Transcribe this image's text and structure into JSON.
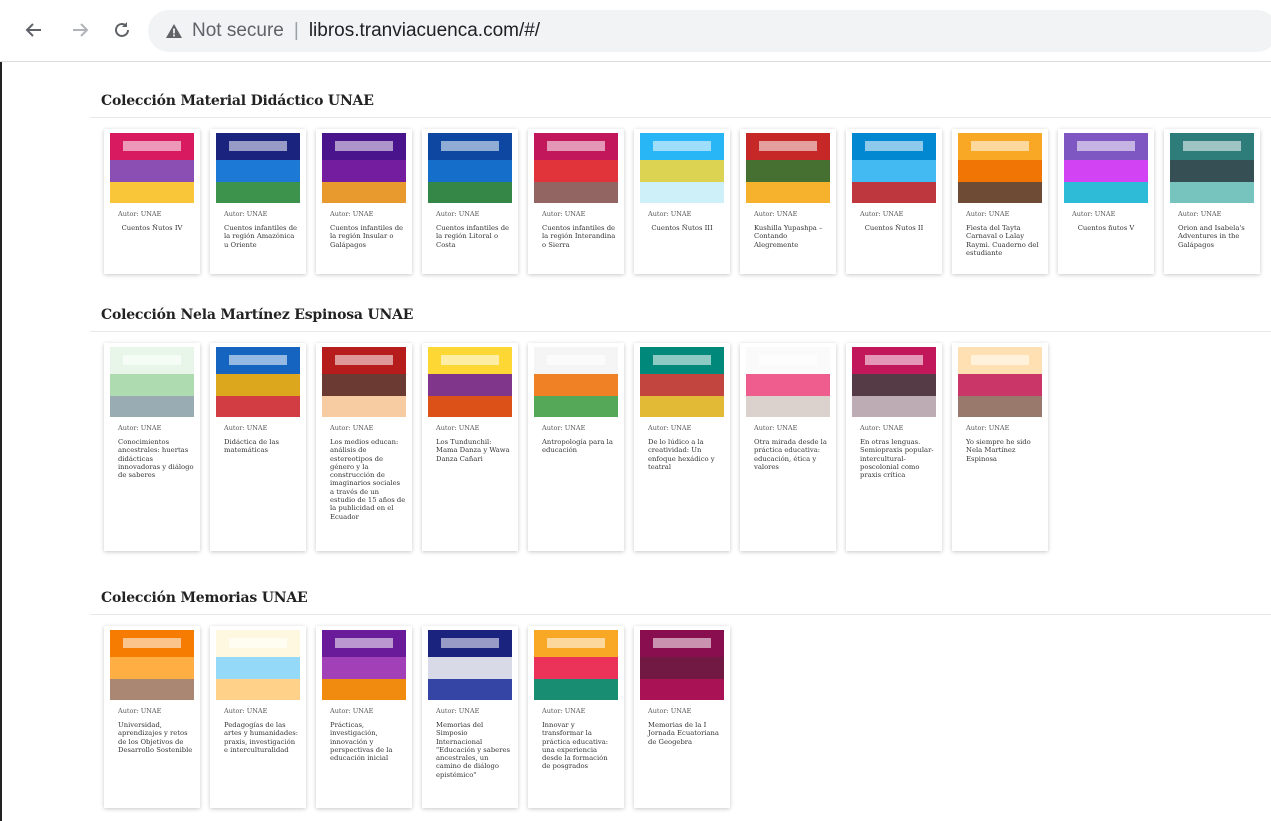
{
  "browser": {
    "back_icon": "arrow-left-icon",
    "forward_icon": "arrow-right-icon",
    "reload_icon": "reload-icon",
    "security_label": "Not secure",
    "separator": "|",
    "url": "libros.tranviacuenca.com/#/"
  },
  "sections": [
    {
      "title": "Colección Material Didáctico UNAE",
      "books": [
        {
          "author": "Autor: UNAE",
          "title": "Cuentos Ñutos IV",
          "center": true,
          "cover": [
            "#d81b60",
            "#7e57c2",
            "#fdd835"
          ]
        },
        {
          "author": "Autor: UNAE",
          "title": "Cuentos infantiles de la región Amazónica u Oriente",
          "cover": [
            "#1a237e",
            "#1e88e5",
            "#43a047"
          ]
        },
        {
          "author": "Autor: UNAE",
          "title": "Cuentos infantiles de la región Insular o Galápagos",
          "cover": [
            "#4a148c",
            "#7b1fa2",
            "#f9a825"
          ]
        },
        {
          "author": "Autor: UNAE",
          "title": "Cuentos infantiles de la región Litoral o Costa",
          "cover": [
            "#0d47a1",
            "#1976d2",
            "#388e3c"
          ]
        },
        {
          "author": "Autor: UNAE",
          "title": "Cuentos infantiles de la región Interandina o Sierra",
          "cover": [
            "#c2185b",
            "#e53935",
            "#8d6e63"
          ]
        },
        {
          "author": "Autor: UNAE",
          "title": "Cuentos Ñutos III",
          "center": true,
          "cover": [
            "#29b6f6",
            "#fdd835",
            "#e0f7fa"
          ]
        },
        {
          "author": "Autor: UNAE",
          "title": "Kushilla Yupashpa – Contando Alegremente",
          "cover": [
            "#c62828",
            "#2e7d32",
            "#fbc02d"
          ]
        },
        {
          "author": "Autor: UNAE",
          "title": "Cuentos Ñutos II",
          "center": true,
          "cover": [
            "#0288d1",
            "#4fc3f7",
            "#d32f2f"
          ]
        },
        {
          "author": "Autor: UNAE",
          "title": "Fiesta del Tayta Carnaval o Lalay Raymi. Cuaderno del estudiante",
          "cover": [
            "#f9a825",
            "#ef6c00",
            "#5d4037"
          ]
        },
        {
          "author": "Autor: UNAE",
          "title": "Cuentos ñutos V",
          "center": true,
          "cover": [
            "#7e57c2",
            "#e040fb",
            "#26c6da"
          ]
        },
        {
          "author": "Autor: UNAE",
          "title": "Orion and Isabela's Adventures in the Galápagos",
          "cover": [
            "#2e7d7a",
            "#37474f",
            "#80cbc4"
          ]
        }
      ]
    },
    {
      "title": "Colección Nela Martínez Espinosa UNAE",
      "books": [
        {
          "author": "Autor: UNAE",
          "title": "Conocimientos ancestrales: huertas didácticas innovadoras y diálogo de saberes",
          "cover": [
            "#e8f5e9",
            "#a5d6a7",
            "#90a4ae"
          ]
        },
        {
          "author": "Autor: UNAE",
          "title": "Didáctica de las matemáticas",
          "cover": [
            "#1565c0",
            "#ffb300",
            "#e53935"
          ]
        },
        {
          "author": "Autor: UNAE",
          "title": "Los medios educan: análisis de estereotipos de género y la construcción de imaginarios sociales a través de un estudio de 15 años de la publicidad en el Ecuador",
          "cover": [
            "#b71c1c",
            "#5d4037",
            "#ffe0b2"
          ]
        },
        {
          "author": "Autor: UNAE",
          "title": "Los Tundunchil: Mama Danza y Wawa Danza Cañari",
          "cover": [
            "#fdd835",
            "#6a1b9a",
            "#d84315"
          ]
        },
        {
          "author": "Autor: UNAE",
          "title": "Antropología para la educación",
          "cover": [
            "#f5f5f5",
            "#ef6c00",
            "#43a047"
          ]
        },
        {
          "author": "Autor: UNAE",
          "title": "De lo lúdico a la creatividad: Un enfoque hexádico y teatral",
          "cover": [
            "#00897b",
            "#e53935",
            "#fbc02d"
          ]
        },
        {
          "author": "Autor: UNAE",
          "title": "Otra mirada desde la práctica educativa: educación, ética y valores",
          "cover": [
            "#fafafa",
            "#ec407a",
            "#d7ccc8"
          ]
        },
        {
          "author": "Autor: UNAE",
          "title": "En otras lenguas. Semiopraxis popular-intercultural-poscolonial como praxis crítica",
          "cover": [
            "#c2185b",
            "#424242",
            "#bdbdbd"
          ]
        },
        {
          "author": "Autor: UNAE",
          "title": "Yo siempre he sido Nela Martínez Espinosa",
          "cover": [
            "#ffe0b2",
            "#c2185b",
            "#8d6e63"
          ]
        }
      ]
    },
    {
      "title": "Colección Memorias UNAE",
      "books": [
        {
          "author": "Autor: UNAE",
          "title": "Universidad, aprendizajes y retos de los Objetivos de Desarrollo Sostenible",
          "cover": [
            "#f57c00",
            "#ffb74d",
            "#a1887f"
          ]
        },
        {
          "author": "Autor: UNAE",
          "title": "Pedagogías de las artes y humanidades: praxis, investigación e interculturalidad",
          "cover": [
            "#fff8e1",
            "#81d4fa",
            "#ffcc80"
          ]
        },
        {
          "author": "Autor: UNAE",
          "title": "Prácticas, investigación, innovación y perspectivas de la educación inicial",
          "cover": [
            "#6a1b9a",
            "#ab47bc",
            "#ff9800"
          ]
        },
        {
          "author": "Autor: UNAE",
          "title": "Memorias del Simposio Internacional \"Educación y saberes ancestrales, un camino de diálogo epistémico\"",
          "cover": [
            "#1a237e",
            "#fafafa",
            "#3949ab"
          ]
        },
        {
          "author": "Autor: UNAE",
          "title": "Innovar y transformar la práctica educativa: una experiencia desde la formación de posgrados",
          "cover": [
            "#f9a825",
            "#e91e63",
            "#00897b"
          ]
        },
        {
          "author": "Autor: UNAE",
          "title": "Memorias de la I Jornada Ecuatoriana de Geogebra",
          "cover": [
            "#880e4f",
            "#6d1b3f",
            "#ad1457"
          ]
        }
      ]
    }
  ]
}
